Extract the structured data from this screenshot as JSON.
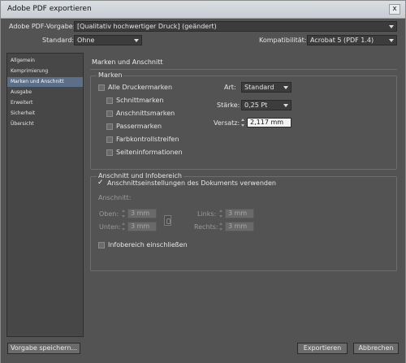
{
  "window": {
    "title": "Adobe PDF exportieren",
    "close_glyph": "x"
  },
  "top": {
    "preset_label": "Adobe PDF-Vorgabe:",
    "preset_value": "[Qualitativ hochwertiger Druck] (geändert)",
    "standard_label": "Standard:",
    "standard_value": "Ohne",
    "compat_label": "Kompatibilität:",
    "compat_value": "Acrobat 5 (PDF 1.4)"
  },
  "sidebar": {
    "items": [
      {
        "label": "Allgemein",
        "selected": false
      },
      {
        "label": "Komprimierung",
        "selected": false
      },
      {
        "label": "Marken und Anschnitt",
        "selected": true
      },
      {
        "label": "Ausgabe",
        "selected": false
      },
      {
        "label": "Erweitert",
        "selected": false
      },
      {
        "label": "Sicherheit",
        "selected": false
      },
      {
        "label": "Übersicht",
        "selected": false
      }
    ]
  },
  "main": {
    "title": "Marken und Anschnitt",
    "marks": {
      "group_title": "Marken",
      "all_marks": {
        "label": "Alle Druckermarken",
        "checked": false
      },
      "items": [
        {
          "label": "Schnittmarken",
          "checked": false
        },
        {
          "label": "Anschnittsmarken",
          "checked": false
        },
        {
          "label": "Passermarken",
          "checked": false
        },
        {
          "label": "Farbkontrollstreifen",
          "checked": false
        },
        {
          "label": "Seiteninformationen",
          "checked": false
        }
      ],
      "type_label": "Art:",
      "type_value": "Standard",
      "weight_label": "Stärke:",
      "weight_value": "0,25 Pt",
      "offset_label": "Versatz:",
      "offset_value": "2,117 mm"
    },
    "bleed": {
      "group_title": "Anschnitt und Infobereich",
      "use_doc": {
        "label": "Anschnittseinstellungen des Dokuments verwenden",
        "checked": true
      },
      "bleed_label": "Anschnitt:",
      "top_label": "Oben:",
      "top_value": "3 mm",
      "bottom_label": "Unten:",
      "bottom_value": "3 mm",
      "left_label": "Links:",
      "left_value": "3 mm",
      "right_label": "Rechts:",
      "right_value": "3 mm",
      "slug": {
        "label": "Infobereich einschließen",
        "checked": false
      }
    }
  },
  "buttons": {
    "save_preset": "Vorgabe speichern...",
    "export": "Exportieren",
    "cancel": "Abbrechen"
  },
  "colors": {
    "panel": "#535353",
    "selection": "#5b6f88",
    "field": "#f2f2f2"
  }
}
